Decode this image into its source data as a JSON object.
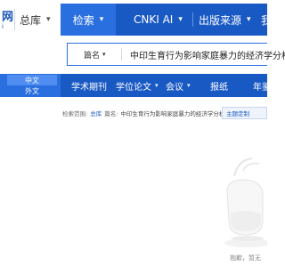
{
  "header": {
    "logo_fragment_top": "网",
    "logo_fragment_bottom": "i",
    "scope_label": "总库"
  },
  "nav": {
    "items": [
      {
        "label": "检索",
        "active": true
      },
      {
        "label": "CNKI AI"
      },
      {
        "label": "出版来源"
      },
      {
        "label": "我"
      }
    ]
  },
  "search": {
    "field": "篇名",
    "query": "中印生育行为影响家庭暴力的经济学分析"
  },
  "tabs": {
    "lang_zh": "中文",
    "lang_en": "外文",
    "items": [
      {
        "label": "学术期刊"
      },
      {
        "label": "学位论文"
      },
      {
        "label": "会议"
      },
      {
        "label": "报纸"
      },
      {
        "label": "年鉴"
      }
    ]
  },
  "criteria": {
    "label": "检索范围:",
    "scope": "总库",
    "field_label": "篇名:",
    "query": "中印生育行为影响家庭暴力的经济学分析",
    "custom_button": "主题定制"
  },
  "empty_state": {
    "message": "抱歉，暂无"
  },
  "colors": {
    "brand_blue": "#1959c4",
    "active_blue": "#2a6fe0"
  }
}
